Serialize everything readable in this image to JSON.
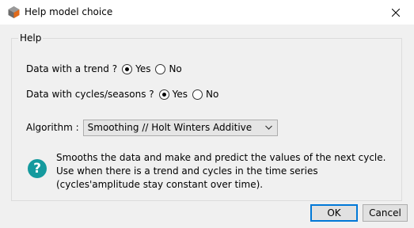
{
  "window": {
    "title": "Help model choice",
    "icon": "app-logo-icon"
  },
  "group": {
    "legend": "Help"
  },
  "trend": {
    "label": "Data with a trend ?",
    "options": [
      "Yes",
      "No"
    ],
    "selected": "Yes"
  },
  "seasons": {
    "label": "Data with cycles/seasons ?",
    "options": [
      "Yes",
      "No"
    ],
    "selected": "Yes"
  },
  "algorithm": {
    "label": "Algorithm :",
    "selected": "Smoothing // Holt Winters Additive"
  },
  "help": {
    "icon": "question-icon",
    "icon_glyph": "?",
    "icon_color": "#159a9e",
    "text": "Smooths the data and make and predict the values of the next cycle. Use when there is a trend and cycles in the time series (cycles'amplitude stay constant over time)."
  },
  "buttons": {
    "ok": "OK",
    "cancel": "Cancel"
  }
}
